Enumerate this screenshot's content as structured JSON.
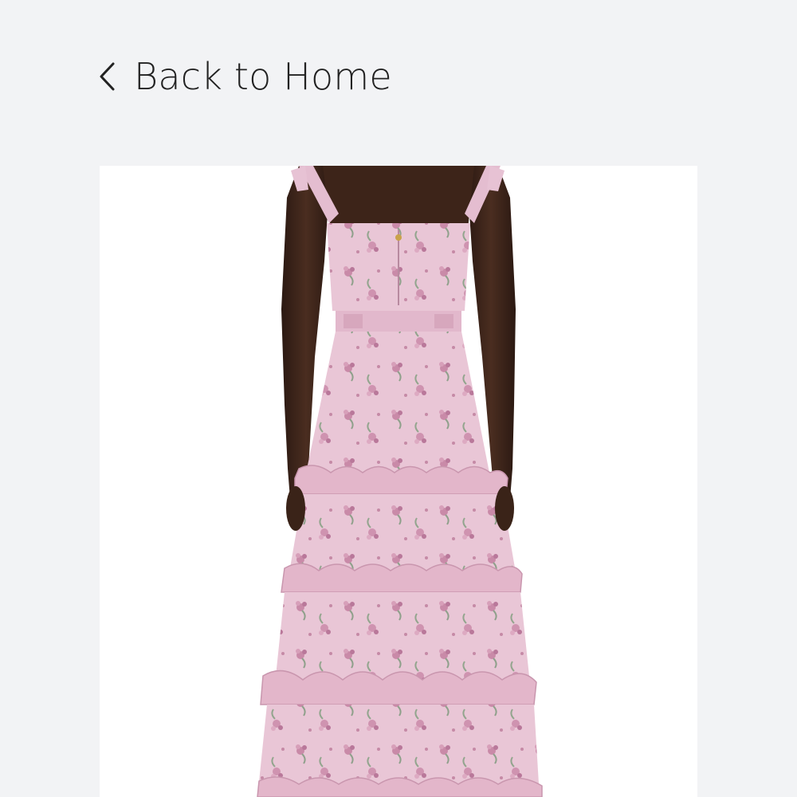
{
  "nav": {
    "back_label": "Back to Home",
    "back_icon": "chevron-left-icon"
  },
  "product": {
    "image_icon": "product-photo-pink-floral-tiered-dress-back-view"
  },
  "colors": {
    "page_background": "#f2f3f5",
    "image_background": "#ffffff",
    "dress_pink": "#e7c2d4",
    "skin": "#3b2419"
  }
}
